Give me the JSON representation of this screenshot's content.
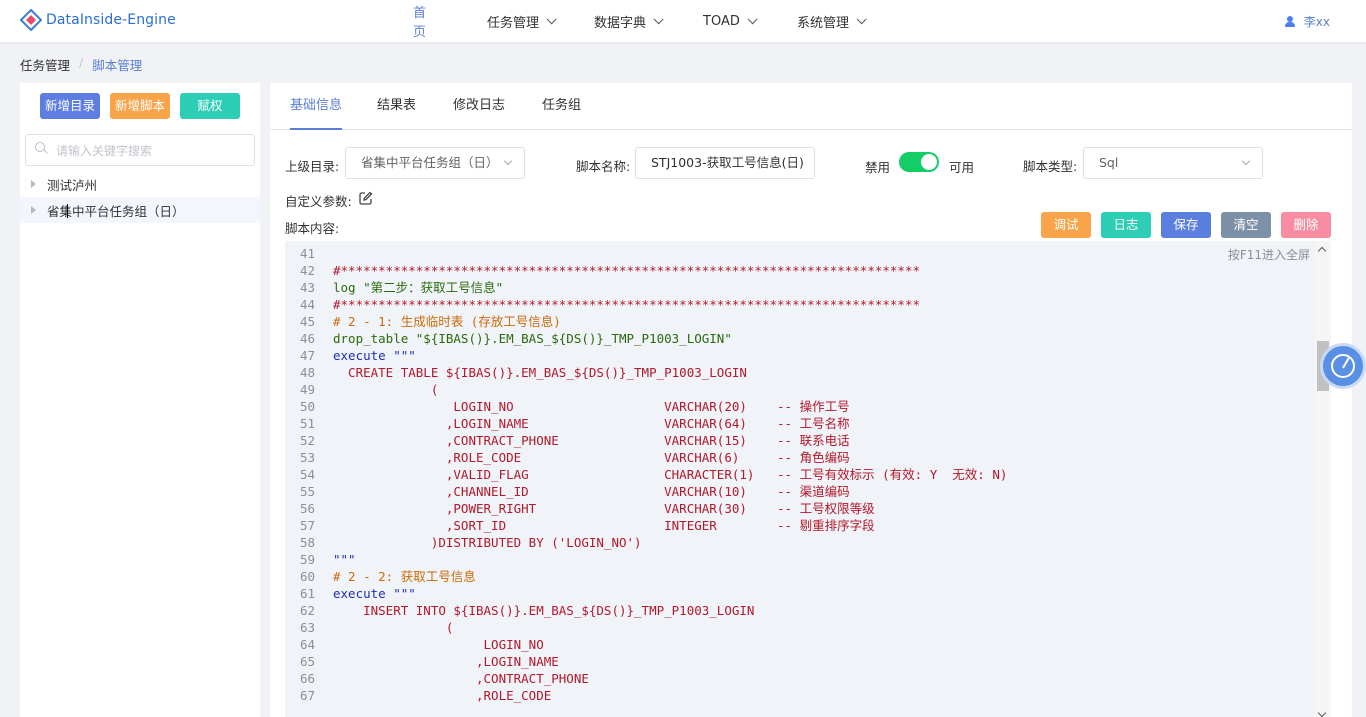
{
  "app": {
    "title": "DataInside-Engine",
    "brand_color": "#2b6fd6"
  },
  "nav": {
    "home": "首页",
    "items": [
      {
        "label": "任务管理"
      },
      {
        "label": "数据字典"
      },
      {
        "label": "TOAD"
      },
      {
        "label": "系统管理"
      }
    ],
    "user": "李xx"
  },
  "breadcrumb": {
    "parent": "任务管理",
    "current": "脚本管理"
  },
  "left": {
    "buttons": {
      "add_dir": "新增目录",
      "add_script": "新增脚本",
      "grant": "赋权"
    },
    "search_placeholder": "请输入关键字搜索",
    "tree": [
      {
        "label": "测试泸州"
      },
      {
        "label": "省集中平台任务组（日）"
      }
    ]
  },
  "tabs": [
    "基础信息",
    "结果表",
    "修改日志",
    "任务组"
  ],
  "form": {
    "parent_label": "上级目录:",
    "parent_value": "省集中平台任务组（日）",
    "name_label": "脚本名称:",
    "name_value": "STJ1003-获取工号信息(日)",
    "disable_label": "禁用",
    "enable_label": "可用",
    "switch_on": true,
    "type_label": "脚本类型:",
    "type_value": "Sql",
    "custom_params_label": "自定义参数:",
    "content_label": "脚本内容:"
  },
  "actions": {
    "debug": "调试",
    "log": "日志",
    "save": "保存",
    "clear": "清空",
    "delete": "删除"
  },
  "editor": {
    "hint": "按F11进入全屏",
    "lines": [
      {
        "n": "41",
        "t": "",
        "c": "c-red"
      },
      {
        "n": "42",
        "t": "#*****************************************************************************",
        "c": "c-red"
      },
      {
        "n": "43",
        "t": "log \"第二步：获取工号信息\"",
        "c": "c-green"
      },
      {
        "n": "44",
        "t": "#*****************************************************************************",
        "c": "c-red"
      },
      {
        "n": "45",
        "t": "# 2 - 1: 生成临时表 (存放工号信息)",
        "c": "c-orange"
      },
      {
        "n": "46",
        "t": "drop_table \"${IBAS()}.EM_BAS_${DS()}_TMP_P1003_LOGIN\"",
        "c": "c-green"
      },
      {
        "n": "47",
        "t": "execute \"\"\"",
        "c": "c-kw"
      },
      {
        "n": "48",
        "t": "  CREATE TABLE ${IBAS()}.EM_BAS_${DS()}_TMP_P1003_LOGIN",
        "c": "c-red"
      },
      {
        "n": "49",
        "t": "             (",
        "c": "c-red"
      },
      {
        "n": "50",
        "t": "                LOGIN_NO                    VARCHAR(20)    -- 操作工号",
        "c": "c-red"
      },
      {
        "n": "51",
        "t": "               ,LOGIN_NAME                  VARCHAR(64)    -- 工号名称",
        "c": "c-red"
      },
      {
        "n": "52",
        "t": "               ,CONTRACT_PHONE              VARCHAR(15)    -- 联系电话",
        "c": "c-red"
      },
      {
        "n": "53",
        "t": "               ,ROLE_CODE                   VARCHAR(6)     -- 角色编码",
        "c": "c-red"
      },
      {
        "n": "54",
        "t": "               ,VALID_FLAG                  CHARACTER(1)   -- 工号有效标示 (有效: Y  无效: N)",
        "c": "c-red"
      },
      {
        "n": "55",
        "t": "               ,CHANNEL_ID                  VARCHAR(10)    -- 渠道编码",
        "c": "c-red"
      },
      {
        "n": "56",
        "t": "               ,POWER_RIGHT                 VARCHAR(30)    -- 工号权限等级",
        "c": "c-red"
      },
      {
        "n": "57",
        "t": "               ,SORT_ID                     INTEGER        -- 剔重排序字段",
        "c": "c-red"
      },
      {
        "n": "58",
        "t": "             )DISTRIBUTED BY ('LOGIN_NO')",
        "c": "c-red"
      },
      {
        "n": "59",
        "t": "\"\"\"",
        "c": "c-kw"
      },
      {
        "n": "60",
        "t": "# 2 - 2: 获取工号信息",
        "c": "c-orange"
      },
      {
        "n": "61",
        "t": "execute \"\"\"",
        "c": "c-kw"
      },
      {
        "n": "62",
        "t": "    INSERT INTO ${IBAS()}.EM_BAS_${DS()}_TMP_P1003_LOGIN",
        "c": "c-red"
      },
      {
        "n": "63",
        "t": "               (",
        "c": "c-red"
      },
      {
        "n": "64",
        "t": "                    LOGIN_NO",
        "c": "c-red"
      },
      {
        "n": "65",
        "t": "                   ,LOGIN_NAME",
        "c": "c-red"
      },
      {
        "n": "66",
        "t": "                   ,CONTRACT_PHONE",
        "c": "c-red"
      },
      {
        "n": "67",
        "t": "                   ,ROLE_CODE",
        "c": "c-red"
      }
    ]
  }
}
